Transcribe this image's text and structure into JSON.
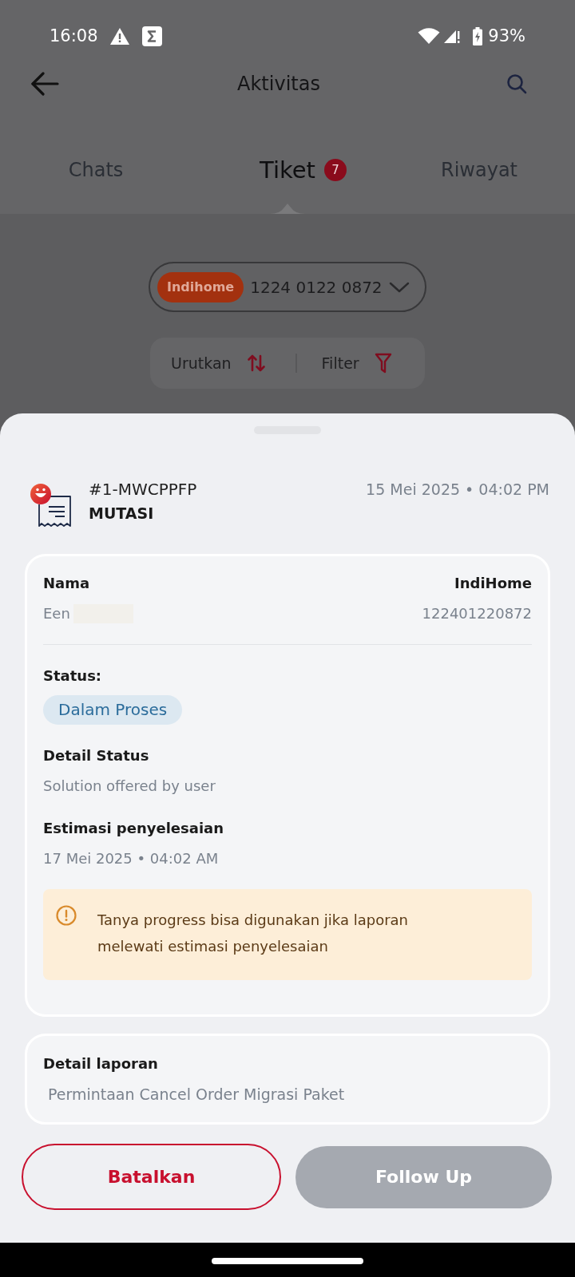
{
  "status_bar": {
    "time": "16:08",
    "battery": "93%"
  },
  "header": {
    "title": "Aktivitas"
  },
  "tabs": [
    {
      "label": "Chats",
      "selected": false
    },
    {
      "label": "Tiket",
      "selected": true,
      "badge": "7"
    },
    {
      "label": "Riwayat",
      "selected": false
    }
  ],
  "account_selector": {
    "tag": "Indihome",
    "number": "1224 0122 0872"
  },
  "toolbar": {
    "sort": "Urutkan",
    "filter": "Filter"
  },
  "ticket": {
    "id": "#1-MWCPPFP",
    "category": "MUTASI",
    "created": "15 Mei 2025 • 04:02 PM"
  },
  "details": {
    "name_label": "Nama",
    "name": "Een",
    "name_redacted": true,
    "service_label": "IndiHome",
    "service_number": "122401220872",
    "status_label": "Status:",
    "status": "Dalam Proses",
    "detail_status_label": "Detail Status",
    "detail_status": "Solution offered by user",
    "estimate_label": "Estimasi penyelesaian",
    "estimate": "17 Mei 2025 • 04:02 AM",
    "notice": "Tanya progress bisa digunakan jika laporan melewati estimasi penyelesaian"
  },
  "report": {
    "label": "Detail laporan",
    "value": "Permintaan Cancel Order Migrasi Paket"
  },
  "actions": [
    {
      "label": "Batalkan",
      "kind": "outline",
      "disabled": false
    },
    {
      "label": "Follow Up",
      "kind": "filled",
      "disabled": true
    }
  ]
}
